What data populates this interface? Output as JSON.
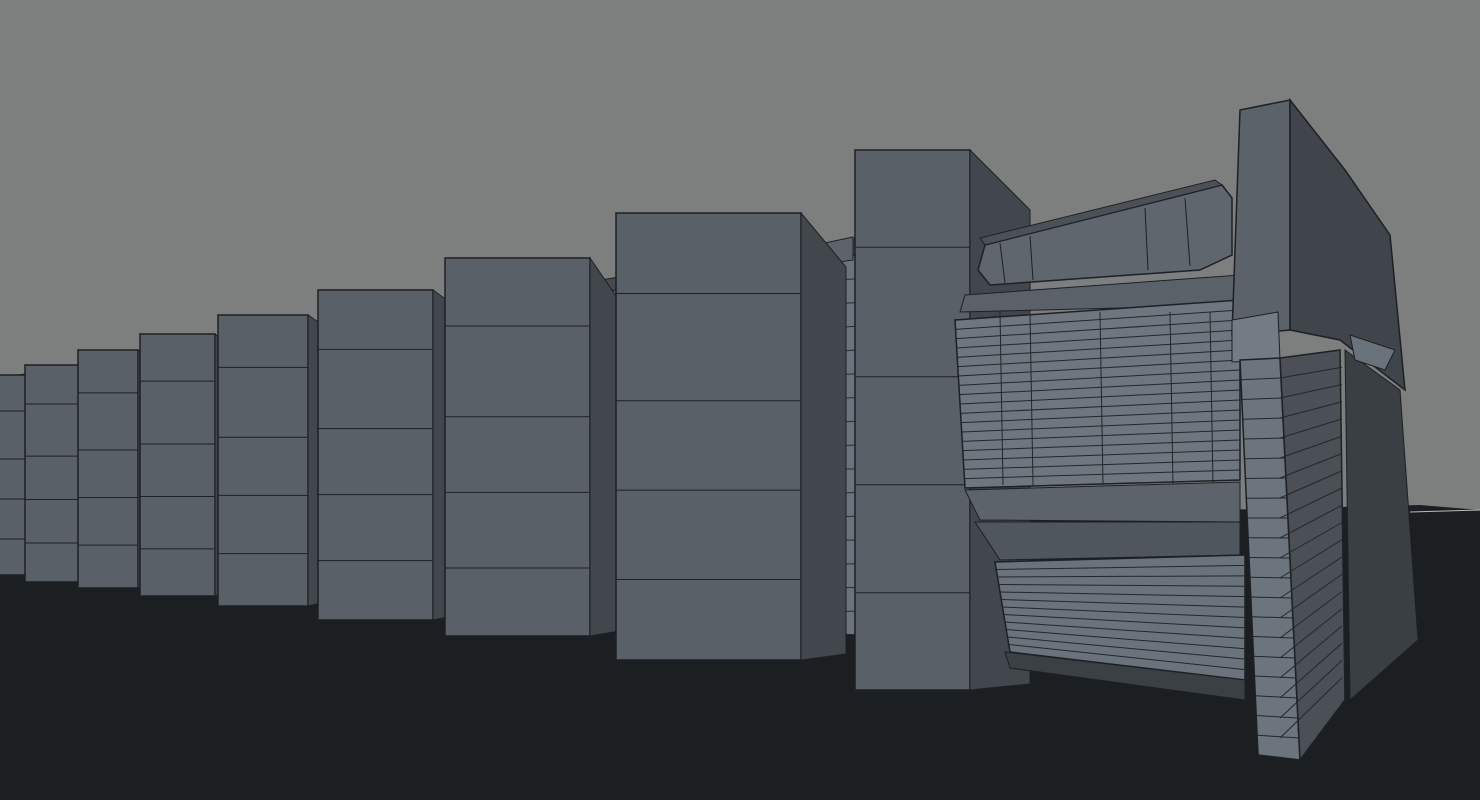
{
  "viewport": {
    "background_sky": "#7d7e7e",
    "ground": "#1b1f22",
    "pillar_front": "#5a6068",
    "pillar_side": "#3d4248",
    "unit_face": "#6b737c",
    "unit_panel": "#767e87",
    "wire": "#1d2024"
  }
}
